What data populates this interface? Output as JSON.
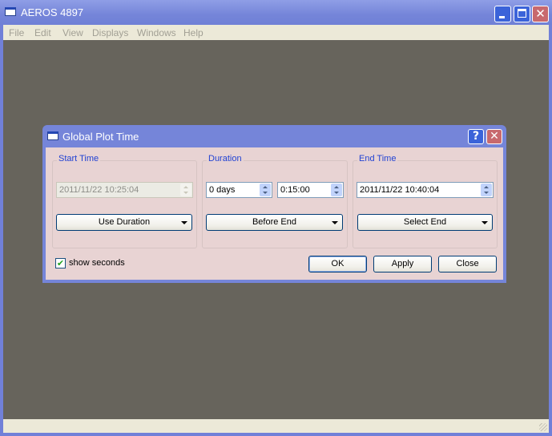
{
  "window": {
    "title": "AEROS 4897",
    "controls": {
      "minimize": "minimize",
      "maximize": "maximize",
      "close": "✕"
    }
  },
  "menubar": {
    "items": [
      "File",
      "Edit",
      "View",
      "Displays",
      "Windows",
      "Help"
    ]
  },
  "dialog": {
    "title": "Global Plot Time",
    "help_glyph": "?",
    "close_glyph": "✕",
    "start_time": {
      "title": "Start Time",
      "value": "2011/11/22 10:25:04",
      "mode": "Use Duration",
      "enabled": false
    },
    "duration": {
      "title": "Duration",
      "days_value": "0 days",
      "time_value": "0:15:00",
      "mode": "Before End"
    },
    "end_time": {
      "title": "End Time",
      "value": "2011/11/22 10:40:04",
      "mode": "Select End"
    },
    "show_seconds": {
      "label": "show seconds",
      "checked": true,
      "glyph": "✔"
    },
    "buttons": {
      "ok": "OK",
      "apply": "Apply",
      "close": "Close"
    }
  }
}
